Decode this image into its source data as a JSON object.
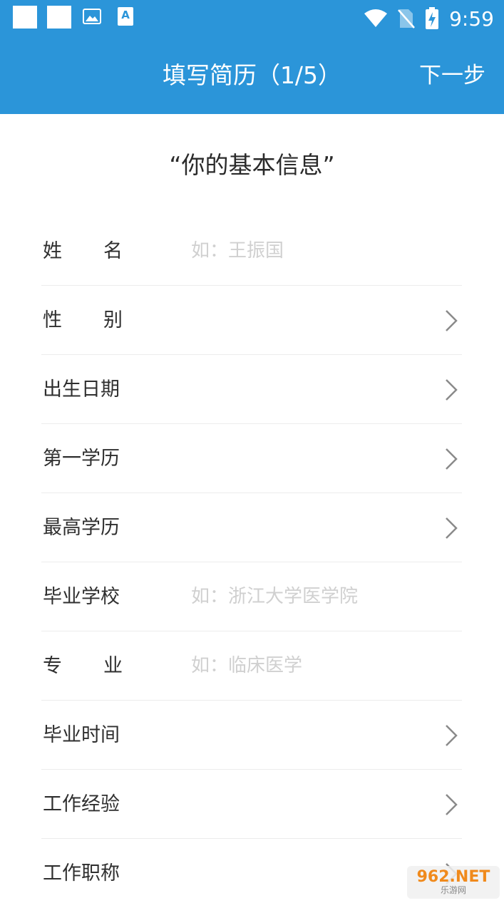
{
  "status_bar": {
    "time": "9:59",
    "icons": [
      "notification-square-icon",
      "notification-square-icon",
      "image-icon",
      "translate-a-icon",
      "wifi-icon",
      "no-sim-icon",
      "battery-charging-icon"
    ],
    "a_glyph": "A"
  },
  "app_bar": {
    "title": "填写简历（1/5）",
    "next_label": "下一步",
    "color": "#2b95d9"
  },
  "section_title": "“你的基本信息”",
  "form": {
    "rows": [
      {
        "label_parts": [
          "姓",
          "名"
        ],
        "placeholder": "如：王振国",
        "type": "input"
      },
      {
        "label_parts": [
          "性",
          "别"
        ],
        "placeholder": "",
        "type": "select"
      },
      {
        "label": "出生日期",
        "type": "select"
      },
      {
        "label": "第一学历",
        "type": "select"
      },
      {
        "label": "最高学历",
        "type": "select"
      },
      {
        "label": "毕业学校",
        "placeholder": "如：浙江大学医学院",
        "type": "input"
      },
      {
        "label_parts": [
          "专",
          "业"
        ],
        "placeholder": "如：临床医学",
        "type": "input"
      },
      {
        "label": "毕业时间",
        "type": "select"
      },
      {
        "label": "工作经验",
        "type": "select"
      },
      {
        "label": "工作职称",
        "type": "select"
      }
    ]
  },
  "watermark": {
    "main": "962.NET",
    "sub": "乐游网"
  }
}
